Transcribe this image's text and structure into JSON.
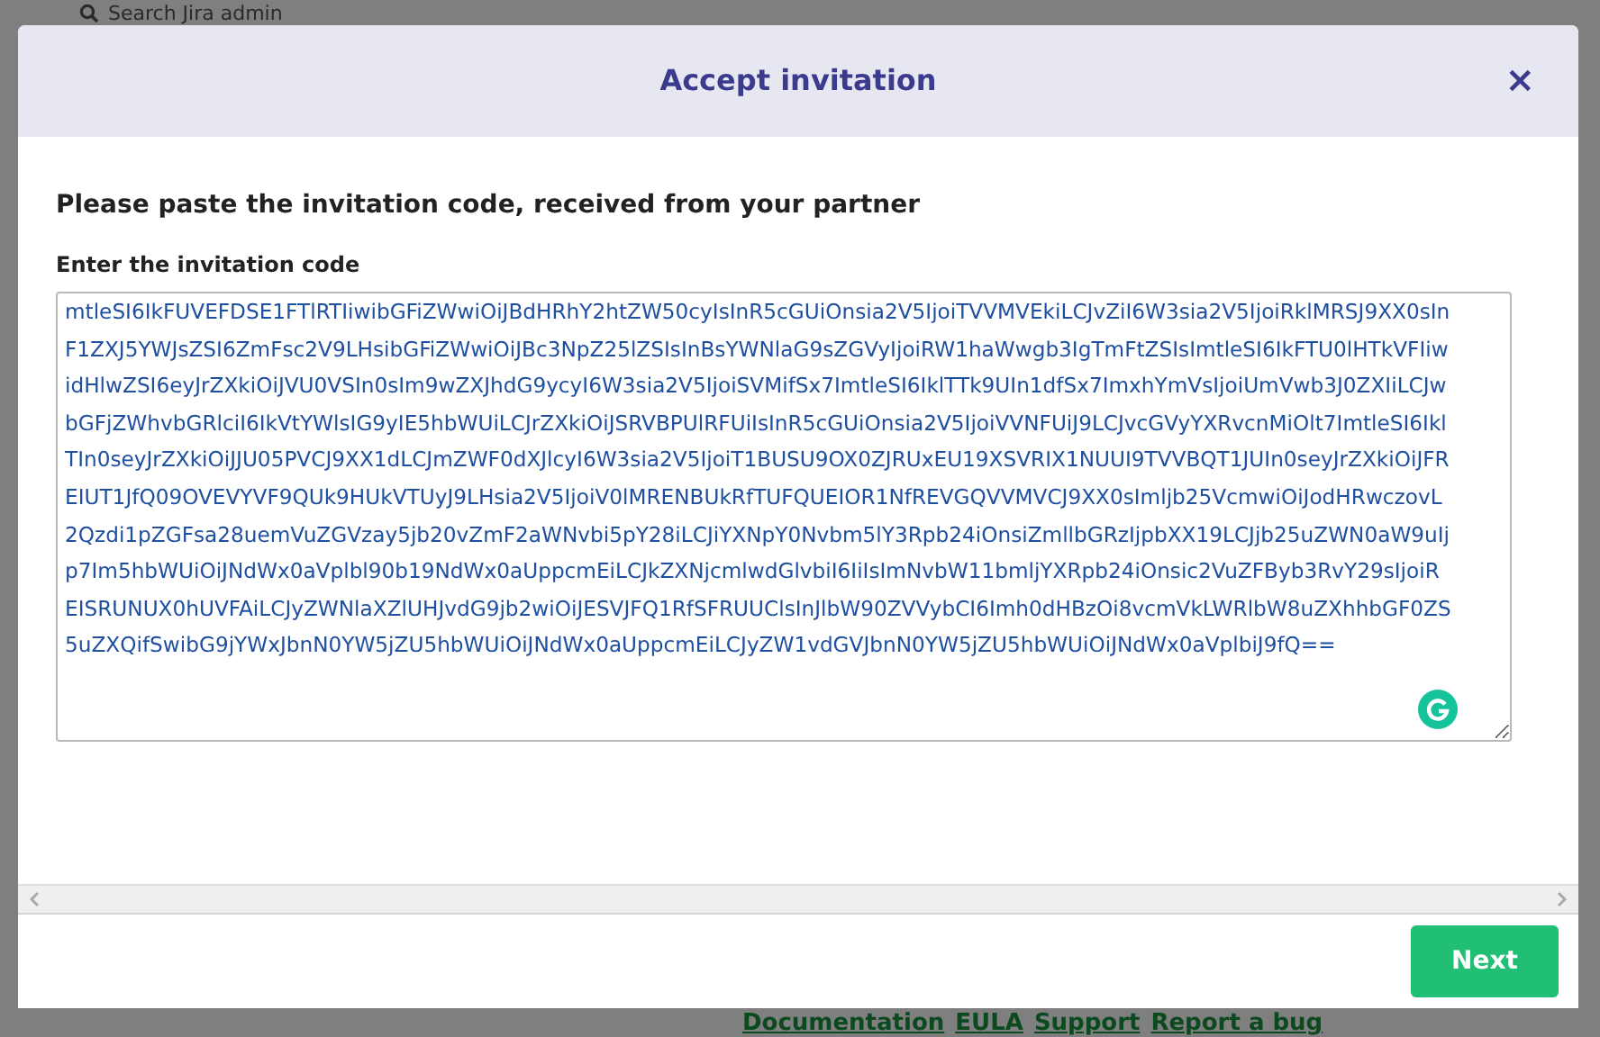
{
  "background": {
    "search_placeholder": "Search Jira admin",
    "footer_links": [
      "Documentation",
      "EULA",
      "Support",
      "Report a bug"
    ]
  },
  "modal": {
    "title": "Accept invitation",
    "close_label": "×",
    "heading": "Please paste the invitation code, received from your partner",
    "field_label": "Enter the invitation code",
    "code": "mtleSI6IkFUVEFDSE1FTlRTIiwibGFiZWwiOiJBdHRhY2htZW50cyIsInR5cGUiOnsia2V5IjoiTVVMVEkiLCJvZiI6W3sia2V5IjoiRklMRSJ9XX0sInF1ZXJ5YWJsZSI6ZmFsc2V9LHsibGFiZWwiOiJBc3NpZ25lZSIsInBsYWNlaG9sZGVyIjoiRW1haWwgb3IgTmFtZSIsImtleSI6IkFTU0lHTkVFIiwidHlwZSI6eyJrZXkiOiJVU0VSIn0sIm9wZXJhdG9ycyI6W3sia2V5IjoiSVMifSx7ImtleSI6IklTTk9UIn1dfSx7ImxhYmVsIjoiUmVwb3J0ZXIiLCJwbGFjZWhvbGRlciI6IkVtYWlsIG9yIE5hbWUiLCJrZXkiOiJSRVBPUlRFUiIsInR5cGUiOnsia2V5IjoiVVNFUiJ9LCJvcGVyYXRvcnMiOlt7ImtleSI6IklTIn0seyJrZXkiOiJJU05PVCJ9XX1dLCJmZWF0dXJlcyI6W3sia2V5IjoiT1BUSU9OX0ZJRUxEU19XSVRIX1NUUI9TVVBQT1JUIn0seyJrZXkiOiJFREIUT1JfQ09OVEVYVF9QUk9HUkVTUyJ9LHsia2V5IjoiV0lMRENBUkRfTUFQUEIOR1NfREVGQVVMVCJ9XX0sImljb25VcmwiOiJodHRwczovL2Qzdi1pZGFsa28uemVuZGVzay5jb20vZmF2aWNvbi5pY28iLCJiYXNpY0Nvbm5lY3Rpb24iOnsiZmllbGRzIjpbXX19LCJjb25uZWN0aW9uIjp7Im5hbWUiOiJNdWx0aVplbl90b19NdWx0aUppcmEiLCJkZXNjcmlwdGlvbiI6IiIsImNvbW11bmljYXRpb24iOnsic2VuZFByb3RvY29sIjoiREISRUNUX0hUVFAiLCJyZWNlaXZlUHJvdG9jb2wiOiJESVJFQ1RfSFRUUClsInJlbW90ZVVybCI6Imh0dHBzOi8vcmVkLWRlbW8uZXhhbGF0ZS5uZXQifSwibG9jYWxJbnN0YW5jZU5hbWUiOiJNdWx0aUppcmEiLCJyZW1vdGVJbnN0YW5jZU5hbWUiOiJNdWx0aVplbiJ9fQ==",
    "next_button": "Next"
  }
}
